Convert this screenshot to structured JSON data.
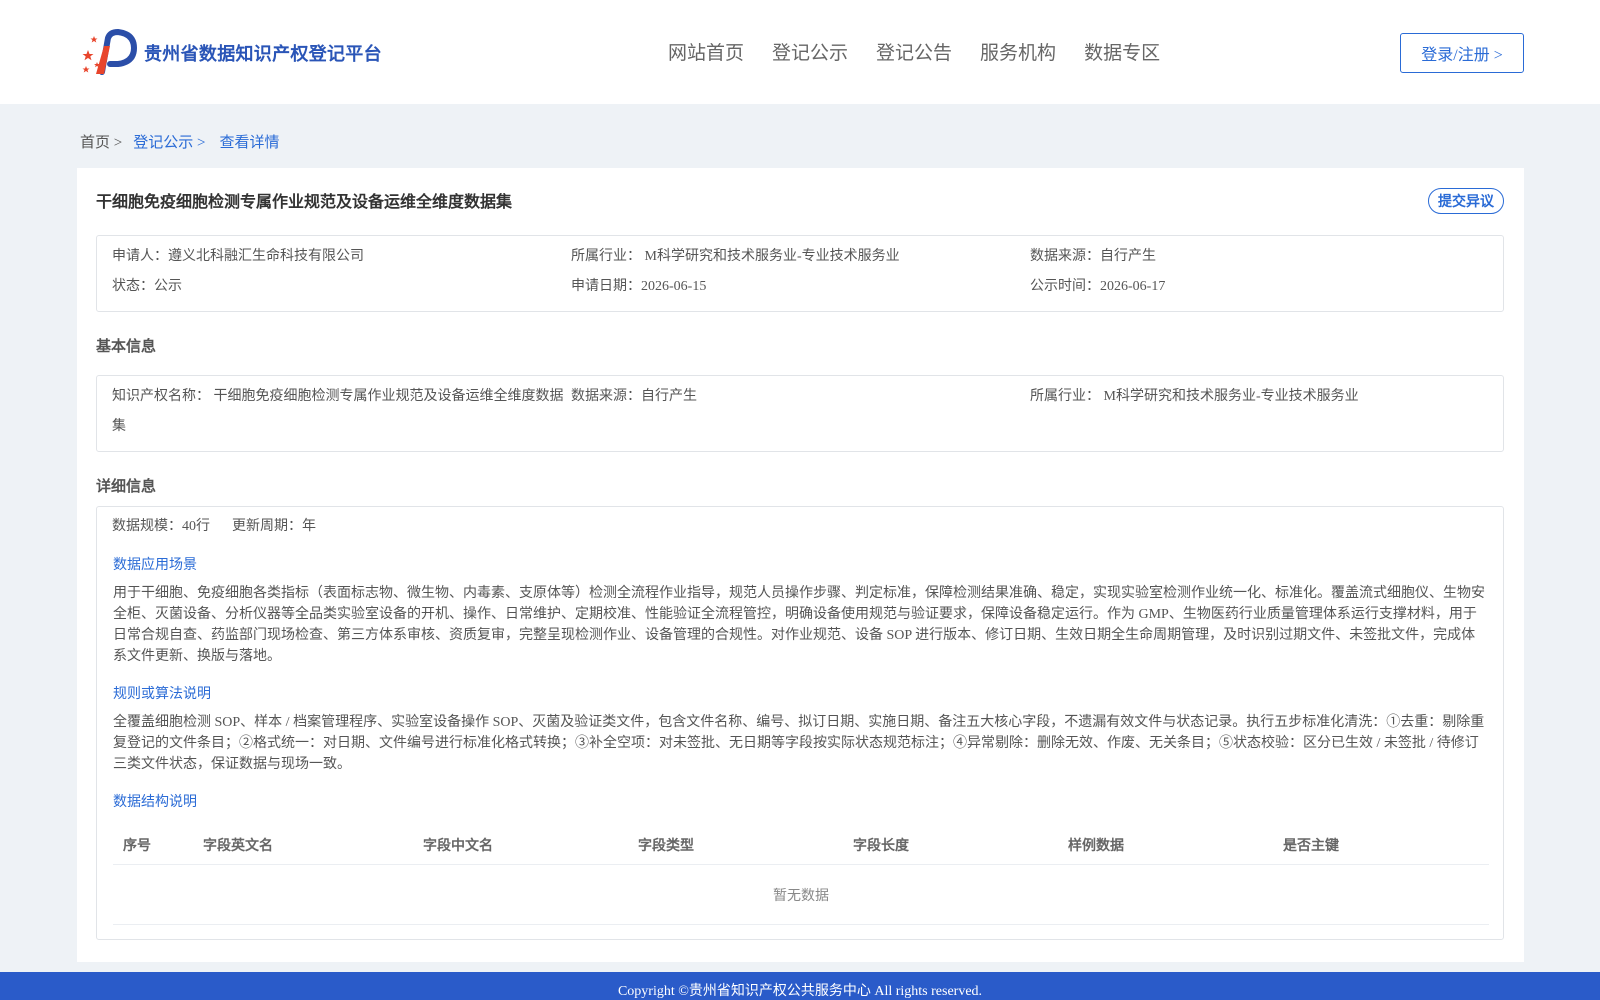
{
  "header": {
    "site_name": "贵州省数据知识产权登记平台",
    "nav": [
      "网站首页",
      "登记公示",
      "登记公告",
      "服务机构",
      "数据专区"
    ],
    "login": "登录/注册 >"
  },
  "breadcrumb": {
    "home": "首页 >",
    "section": "登记公示 >",
    "current": "查看详情"
  },
  "detail": {
    "title": "干细胞免疫细胞检测专属作业规范及设备运维全维度数据集",
    "objection_button": "提交异议",
    "summary": {
      "applicant": "申请人：遵义北科融汇生命科技有限公司",
      "industry": "所属行业： M科学研究和技术服务业-专业技术服务业",
      "source": "数据来源：自行产生",
      "status": "状态：公示",
      "apply_date": "申请日期：2026-06-15",
      "publish_date": "公示时间：2026-06-17"
    },
    "basic": {
      "heading": "基本信息",
      "ip_name_line1": "知识产权名称： 干细胞免疫细胞检测专属作业规范及设备运维全维度数据",
      "ip_name_line2": "集",
      "source": "数据来源：自行产生",
      "industry": "所属行业： M科学研究和技术服务业-专业技术服务业"
    },
    "details": {
      "heading": "详细信息",
      "scale": "数据规模：40行",
      "cycle": "更新周期：年",
      "scenario_title": "数据应用场景",
      "scenario_text": "用于干细胞、免疫细胞各类指标（表面标志物、微生物、内毒素、支原体等）检测全流程作业指导，规范人员操作步骤、判定标准，保障检测结果准确、稳定，实现实验室检测作业统一化、标准化。覆盖流式细胞仪、生物安全柜、灭菌设备、分析仪器等全品类实验室设备的开机、操作、日常维护、定期校准、性能验证全流程管控，明确设备使用规范与验证要求，保障设备稳定运行。作为 GMP、生物医药行业质量管理体系运行支撑材料，用于日常合规自查、药监部门现场检查、第三方体系审核、资质复审，完整呈现检测作业、设备管理的合规性。对作业规范、设备 SOP 进行版本、修订日期、生效日期全生命周期管理，及时识别过期文件、未签批文件，完成体系文件更新、换版与落地。",
      "rules_title": "规则或算法说明",
      "rules_text": "全覆盖细胞检测 SOP、样本 / 档案管理程序、实验室设备操作 SOP、灭菌及验证类文件，包含文件名称、编号、拟订日期、实施日期、备注五大核心字段，不遗漏有效文件与状态记录。执行五步标准化清洗：①去重：剔除重复登记的文件条目；②格式统一：对日期、文件编号进行标准化格式转换；③补全空项：对未签批、无日期等字段按实际状态规范标注；④异常剔除：删除无效、作废、无关条目；⑤状态校验：区分已生效 / 未签批 / 待修订三类文件状态，保证数据与现场一致。",
      "structure_title": "数据结构说明",
      "table_headers": [
        "序号",
        "字段英文名",
        "字段中文名",
        "字段类型",
        "字段长度",
        "样例数据",
        "是否主键"
      ],
      "table_empty": "暂无数据"
    }
  },
  "footer": {
    "copyright": "Copyright ©贵州省知识产权公共服务中心 All rights reserved."
  },
  "colors": {
    "brand_blue": "#2a6bd6",
    "footer_blue": "#2a5bc9",
    "logo_red": "#e8452c",
    "logo_navy": "#2b4ea8"
  },
  "icons": {
    "logo": "logo-emblem-icon"
  }
}
